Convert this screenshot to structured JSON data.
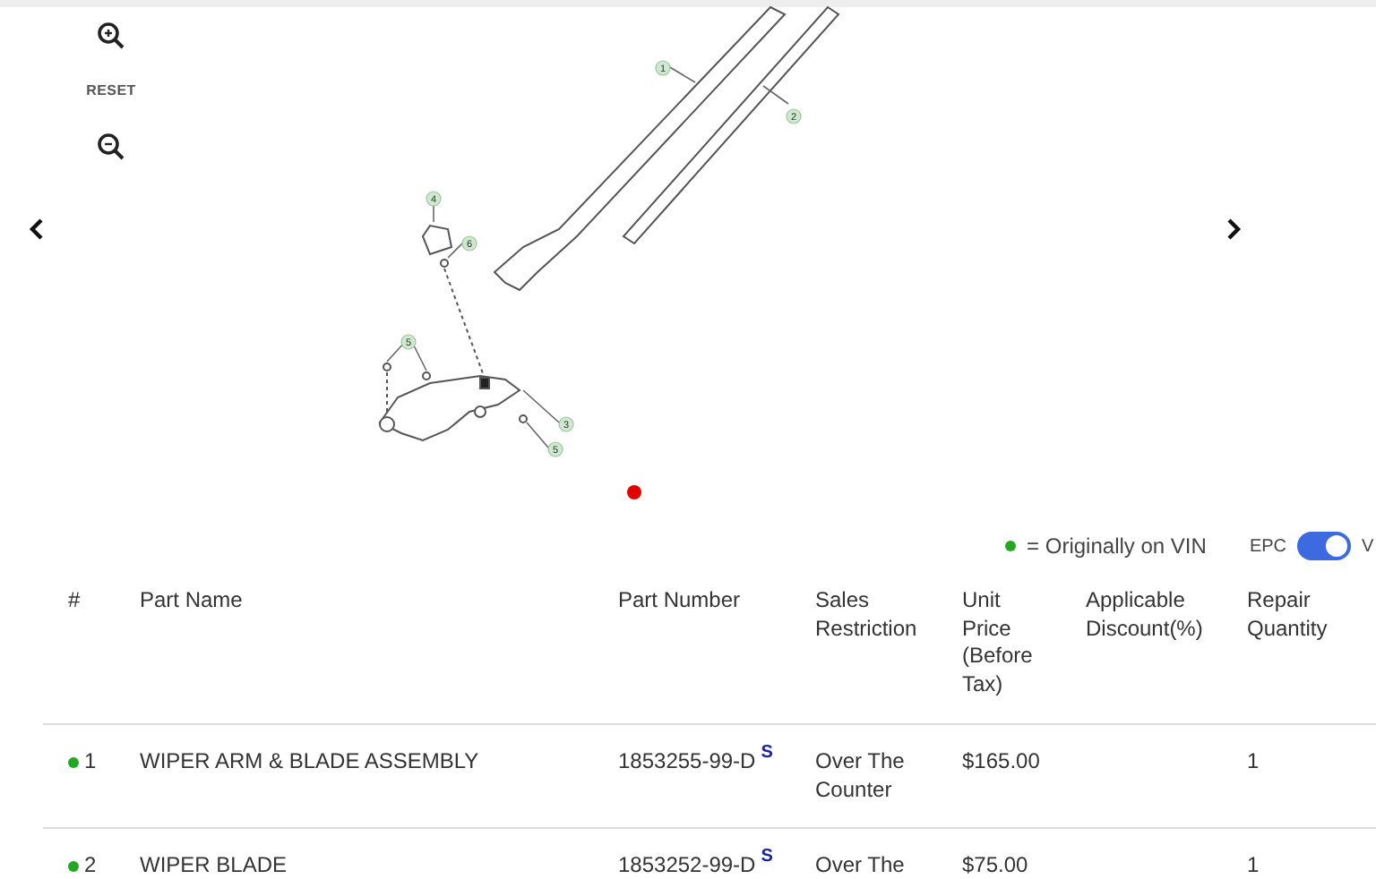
{
  "viewer": {
    "reset": "RESET",
    "callouts": [
      "1",
      "2",
      "4",
      "6",
      "5",
      "3",
      "5"
    ],
    "pager": [
      {
        "selected": true
      }
    ]
  },
  "legend": {
    "text": "= Originally on VIN"
  },
  "toggle": {
    "label": "EPC",
    "on": true,
    "label_after": "V"
  },
  "table": {
    "columns": [
      "#",
      "Part Name",
      "Part Number",
      "Sales Restriction",
      "Unit Price (Before Tax)",
      "Applicable Discount(%)",
      "Repair Quantity"
    ],
    "rows": [
      {
        "index": "1",
        "on_vin": true,
        "part_name": "WIPER ARM & BLADE ASSEMBLY",
        "part_number": "1853255-99-D",
        "flag": "S",
        "sales_restriction": "Over The Counter",
        "unit_price": "$165.00",
        "quantity": "1"
      },
      {
        "index": "2",
        "on_vin": true,
        "part_name": "WIPER BLADE",
        "part_number": "1853252-99-D",
        "flag": "S",
        "sales_restriction": "Over The",
        "unit_price": "$75.00",
        "quantity": "1"
      }
    ]
  }
}
